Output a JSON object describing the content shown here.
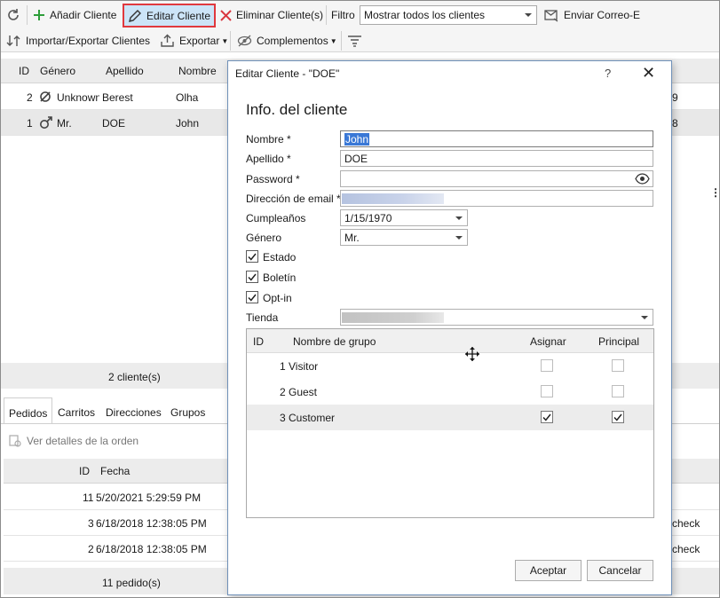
{
  "toolbar": {
    "add_label": "Añadir Cliente",
    "edit_label": "Editar Cliente",
    "delete_label": "Eliminar Cliente(s)",
    "filter_label": "Filtro",
    "filter_value": "Mostrar todos los clientes",
    "email_label": "Enviar Correo-E",
    "import_export_label": "Importar/Exportar Clientes",
    "export_label": "Exportar",
    "addons_label": "Complementos",
    "colors": {
      "add": "#2e9e3a",
      "delete": "#d9363e",
      "active_border": "#e0393e"
    }
  },
  "customers": {
    "columns": [
      "ID",
      "Género",
      "Apellido",
      "Nombre"
    ],
    "rows": [
      {
        "id": "2",
        "gender": "Unknown",
        "last": "Berest",
        "first": "Olha",
        "tail": "9"
      },
      {
        "id": "1",
        "gender": "Mr.",
        "last": "DOE",
        "first": "John",
        "tail": "8"
      }
    ],
    "count": "2 cliente(s)"
  },
  "tabs": [
    "Pedidos",
    "Carritos",
    "Direcciones",
    "Grupos"
  ],
  "orders": {
    "view_details": "Ver detalles de la orden",
    "columns": [
      "ID",
      "Fecha"
    ],
    "rows": [
      {
        "id": "11",
        "date": "5/20/2021 5:29:59 PM",
        "tail": ""
      },
      {
        "id": "3",
        "date": "6/18/2018 12:38:05 PM",
        "tail": "check"
      },
      {
        "id": "2",
        "date": "6/18/2018 12:38:05 PM",
        "tail": "check"
      }
    ],
    "count": "11 pedido(s)"
  },
  "dialog": {
    "title": "Editar Cliente - \"DOE\"",
    "help": "?",
    "close": "✕",
    "section": "Info. del cliente",
    "labels": {
      "first_name": "Nombre *",
      "last_name": "Apellido *",
      "password": "Password *",
      "email": "Dirección de email *",
      "birthday": "Cumpleaños",
      "gender": "Género",
      "status": "Estado",
      "newsletter": "Boletín",
      "optin": "Opt-in",
      "store": "Tienda"
    },
    "values": {
      "first_name": "John",
      "last_name": "DOE",
      "password": "",
      "birthday": "1/15/1970",
      "gender": "Mr."
    },
    "groups": {
      "columns": [
        "ID",
        "Nombre de grupo",
        "Asignar",
        "Principal"
      ],
      "rows": [
        {
          "id": "1",
          "name": "Visitor",
          "assign": false,
          "main": false
        },
        {
          "id": "2",
          "name": "Guest",
          "assign": false,
          "main": false
        },
        {
          "id": "3",
          "name": "Customer",
          "assign": true,
          "main": true
        }
      ]
    },
    "ok": "Aceptar",
    "cancel": "Cancelar"
  }
}
